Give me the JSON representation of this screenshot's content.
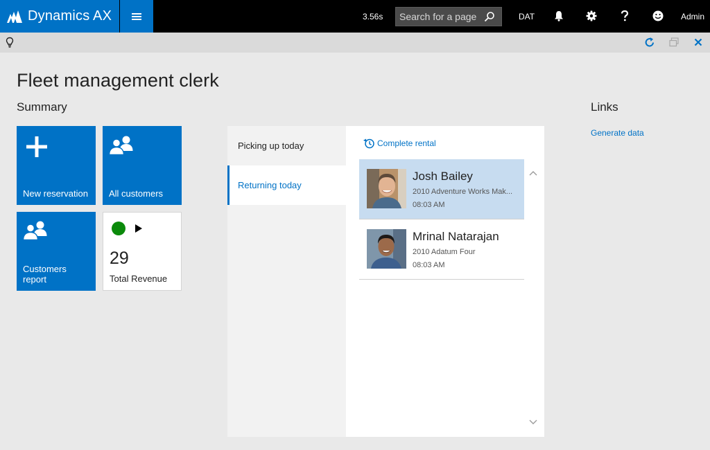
{
  "topbar": {
    "app_name": "Dynamics AX",
    "timer": "3.56s",
    "search_placeholder": "Search for a page",
    "company": "DAT",
    "user": "Admin"
  },
  "page": {
    "title": "Fleet management clerk",
    "summary_heading": "Summary",
    "links_heading": "Links",
    "links": [
      "Generate data"
    ]
  },
  "tiles": {
    "new_reservation": "New reservation",
    "all_customers": "All customers",
    "customers_report": "Customers report",
    "revenue_value": "29",
    "revenue_label": "Total Revenue",
    "revenue_status_color": "#0b8a0b"
  },
  "panel": {
    "tabs": [
      "Picking up today",
      "Returning today"
    ],
    "active_tab": 1,
    "action_label": "Complete rental",
    "rentals": [
      {
        "name": "Josh Bailey",
        "vehicle": "2010 Adventure Works Mak...",
        "time": "08:03 AM",
        "selected": true
      },
      {
        "name": "Mrinal Natarajan",
        "vehicle": "2010 Adatum Four",
        "time": "08:03 AM",
        "selected": false
      }
    ]
  },
  "colors": {
    "accent": "#0072c6",
    "topbar": "#000000",
    "selection": "#c7dcf0"
  }
}
